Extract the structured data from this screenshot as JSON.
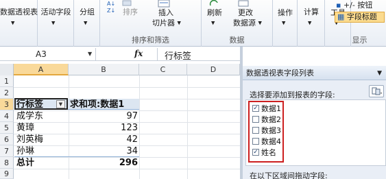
{
  "ribbon": {
    "pivot_table_label": "数据透视表",
    "active_field_label": "活动字段",
    "group_label": "分组",
    "sort_label": "排序",
    "insert_slicer_line1": "插入",
    "insert_slicer_line2": "切片器",
    "sort_filter_group": "排序和筛选",
    "refresh_label": "刷新",
    "change_source_line1": "更改",
    "change_source_line2": "数据源",
    "data_group": "数据",
    "actions_label": "操作",
    "calculations_label": "计算",
    "tools_label": "工具",
    "plus_minus_label": "+/- 按钮",
    "field_headers_label": "字段标题",
    "show_group": "显示"
  },
  "formula_bar": {
    "name_box": "A3",
    "fx": "fx",
    "value": "行标签"
  },
  "columns": [
    "A",
    "B",
    "C",
    "D"
  ],
  "rows": [
    "1",
    "2",
    "3",
    "4",
    "5",
    "6",
    "7",
    "8",
    "9"
  ],
  "pivot": {
    "row_label_header": "行标签",
    "value_header": "求和项:数据1",
    "rows": [
      {
        "name": "成学东",
        "value": "97"
      },
      {
        "name": "黄璋",
        "value": "123"
      },
      {
        "name": "刘英梅",
        "value": "42"
      },
      {
        "name": "孙琳",
        "value": "34"
      }
    ],
    "total_label": "总计",
    "total_value": "296"
  },
  "field_list": {
    "title": "数据透视表字段列表",
    "choose_label": "选择要添加到报表的字段:",
    "fields": [
      {
        "label": "数据1",
        "checked": "✓"
      },
      {
        "label": "数据2",
        "checked": ""
      },
      {
        "label": "数据3",
        "checked": ""
      },
      {
        "label": "数据4",
        "checked": ""
      },
      {
        "label": "姓名",
        "checked": "✓"
      }
    ],
    "drag_label": "在以下区域间拖动字段:"
  }
}
